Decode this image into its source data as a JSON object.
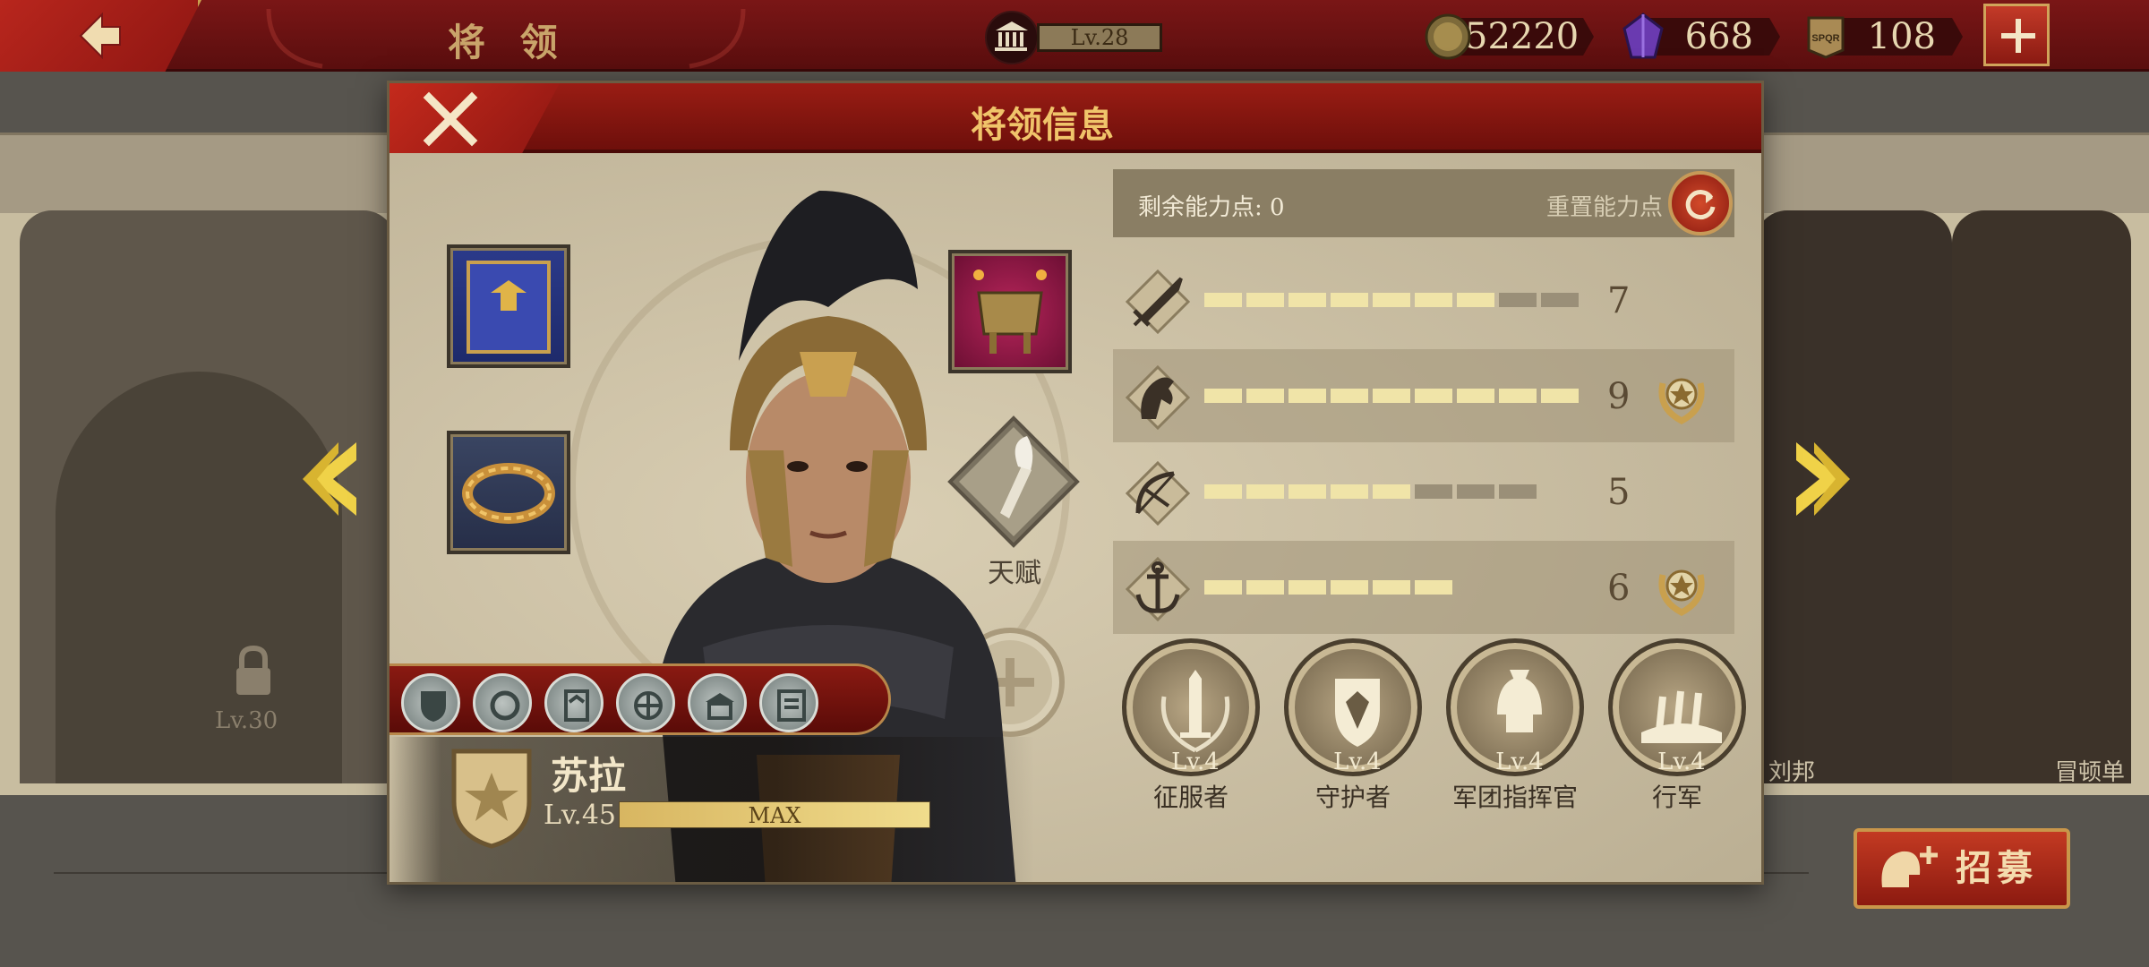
{
  "topbar": {
    "title": "将 领",
    "level": "Lv.28",
    "gold": "52220",
    "gems": "668",
    "tokens": "108",
    "token_icon_text": "SPQR"
  },
  "heroes_bg": {
    "locked_level": "Lv.30",
    "right_name_1": "刘邦",
    "right_name_2": "冒顿单"
  },
  "recruit_label": "招募",
  "modal": {
    "title": "将领信息",
    "talent_label": "天赋",
    "hero": {
      "name": "苏拉",
      "level": "Lv.45",
      "exp_text": "MAX",
      "exp_fraction": 1.0
    },
    "points": {
      "label": "剩余能力点: 0",
      "reset_label": "重置能力点"
    },
    "stats": [
      {
        "icon": "sword-icon",
        "value": "7",
        "filled": 7,
        "total": 9,
        "badge": false
      },
      {
        "icon": "horse-icon",
        "value": "9",
        "filled": 9,
        "total": 9,
        "badge": true
      },
      {
        "icon": "bow-icon",
        "value": "5",
        "filled": 5,
        "total": 8,
        "badge": false
      },
      {
        "icon": "anchor-icon",
        "value": "6",
        "filled": 6,
        "total": 6,
        "badge": true
      }
    ],
    "medals": [
      {
        "name": "征服者",
        "level": "Lv.4"
      },
      {
        "name": "守护者",
        "level": "Lv.4"
      },
      {
        "name": "军团指挥官",
        "level": "Lv.4"
      },
      {
        "name": "行军",
        "level": "Lv.4"
      }
    ]
  },
  "colors": {
    "crimson": "#7a1616",
    "gold": "#f0c46a",
    "parchment": "#c8bda0"
  }
}
